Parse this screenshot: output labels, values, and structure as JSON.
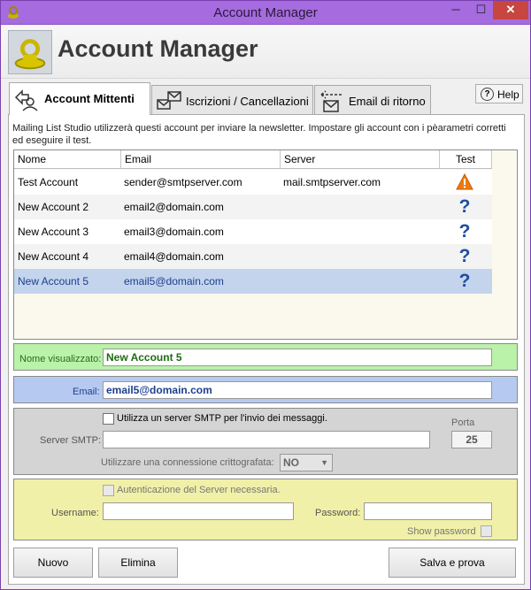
{
  "window": {
    "title": "Account Manager",
    "minimize": "─",
    "maximize": "☐",
    "close": "✕"
  },
  "header": {
    "title": "Account Manager"
  },
  "tabs": [
    {
      "label": "Account Mittenti",
      "active": true
    },
    {
      "label": "Iscrizioni / Cancellazioni",
      "active": false
    },
    {
      "label": "Email di ritorno",
      "active": false
    }
  ],
  "help": {
    "label": "Help"
  },
  "description": "Mailing List Studio utilizzerà questi account per inviare la newsletter. Impostare gli account con i pèarametri corretti ed eseguire il test.",
  "table": {
    "columns": [
      "Nome",
      "Email",
      "Server",
      "Test"
    ],
    "rows": [
      {
        "name": "Test Account",
        "email": "sender@smtpserver.com",
        "server": "mail.smtpserver.com",
        "test": "warning"
      },
      {
        "name": "New Account 2",
        "email": "email2@domain.com",
        "server": "",
        "test": "?"
      },
      {
        "name": "New Account 3",
        "email": "email3@domain.com",
        "server": "",
        "test": "?"
      },
      {
        "name": "New Account 4",
        "email": "email4@domain.com",
        "server": "",
        "test": "?"
      },
      {
        "name": "New Account 5",
        "email": "email5@domain.com",
        "server": "",
        "test": "?"
      }
    ],
    "selected_index": 4
  },
  "form": {
    "display_name_label": "Nome visualizzato:",
    "display_name_value": "New Account 5",
    "email_label": "Email:",
    "email_value": "email5@domain.com",
    "smtp_checkbox_label": "Utilizza un server SMTP per l'invio dei messaggi.",
    "smtp_server_label": "Server SMTP:",
    "smtp_server_value": "",
    "port_label": "Porta",
    "port_value": "25",
    "encryption_label": "Utilizzare una connessione crittografata:",
    "encryption_value": "NO",
    "auth_checkbox_label": "Autenticazione del Server necessaria.",
    "username_label": "Username:",
    "username_value": "",
    "password_label": "Password:",
    "password_value": "",
    "show_password_label": "Show password"
  },
  "buttons": {
    "new": "Nuovo",
    "delete": "Elimina",
    "save_test": "Salva e prova"
  }
}
